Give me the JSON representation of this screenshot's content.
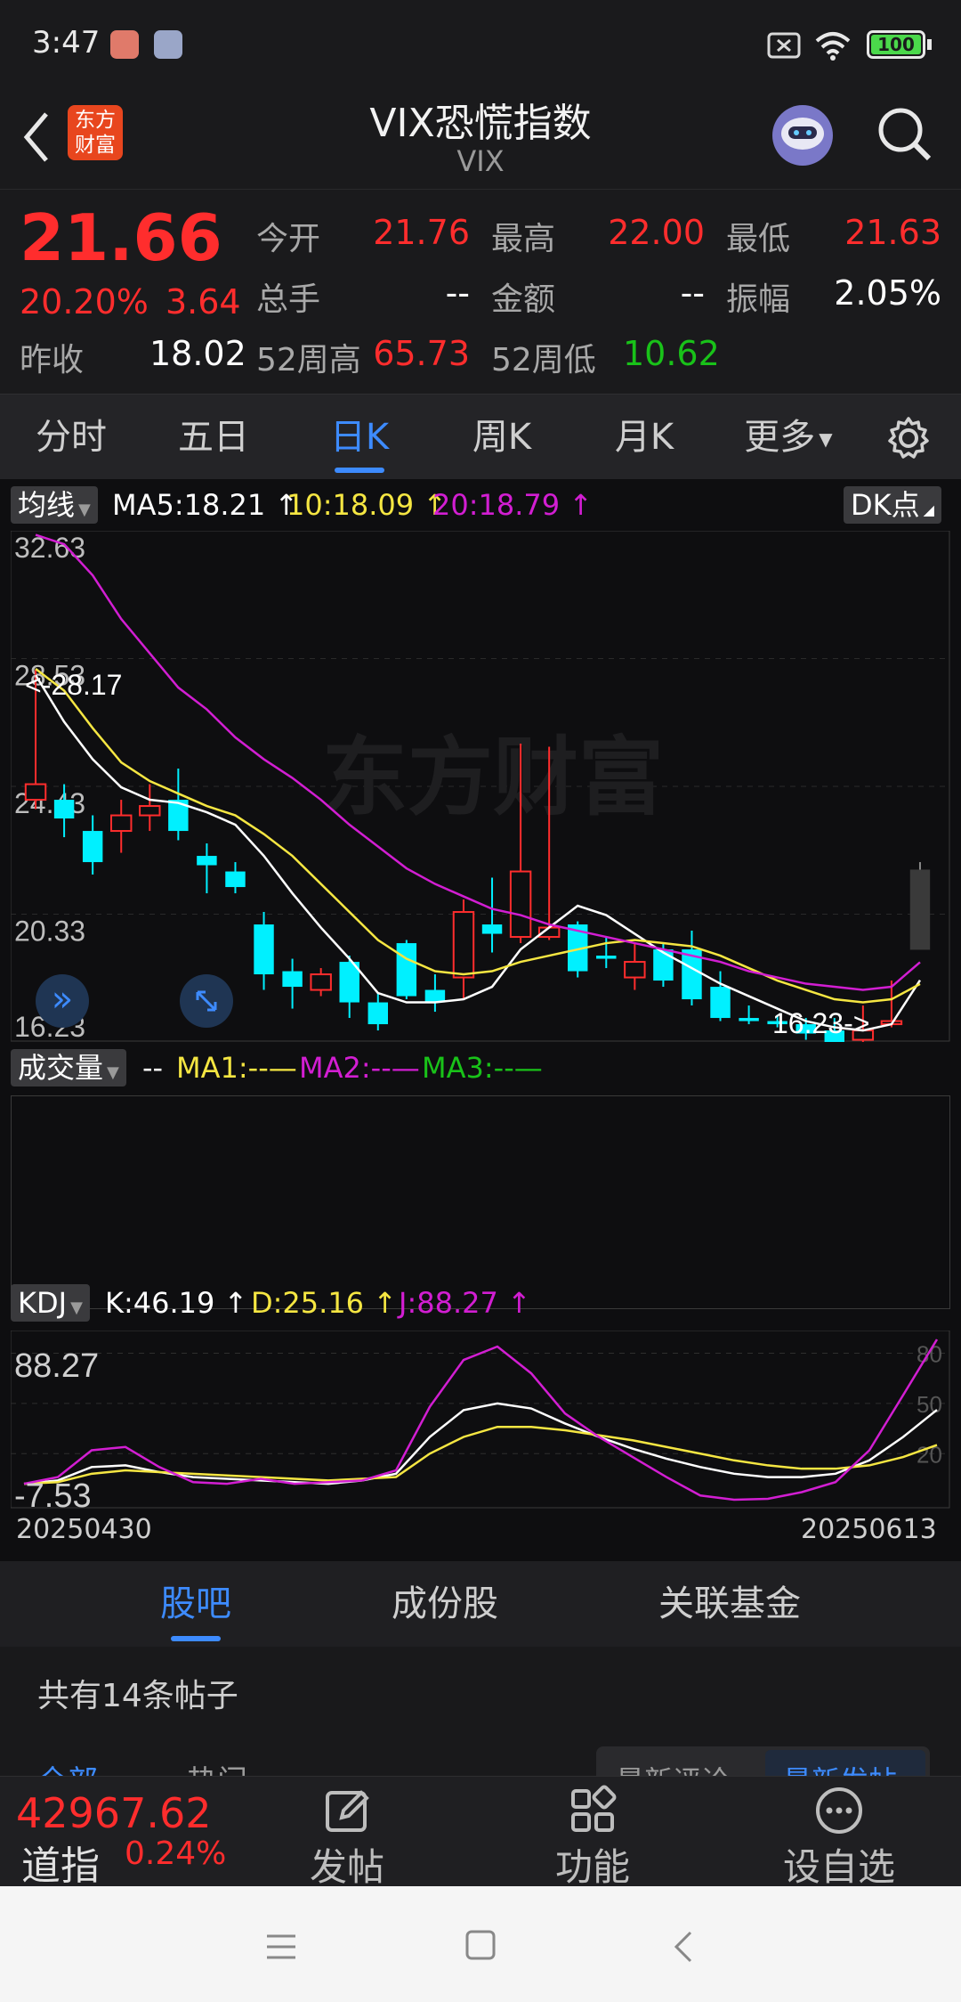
{
  "status": {
    "time": "3:47",
    "battery": "100"
  },
  "header": {
    "logo_line1": "东方",
    "logo_line2": "财富",
    "title": "VIX恐慌指数",
    "subtitle": "VIX"
  },
  "quote": {
    "price": "21.66",
    "change_pct": "20.20%",
    "change": "3.64",
    "prev_close_label": "昨收",
    "prev_close": "18.02",
    "open_label": "今开",
    "open": "21.76",
    "high_label": "最高",
    "high": "22.00",
    "low_label": "最低",
    "low": "21.63",
    "volume_label": "总手",
    "volume": "--",
    "amount_label": "金额",
    "amount": "--",
    "amplitude_label": "振幅",
    "amplitude": "2.05%",
    "wk52_high_label": "52周高",
    "wk52_high": "65.73",
    "wk52_low_label": "52周低",
    "wk52_low": "10.62"
  },
  "tabs": [
    "分时",
    "五日",
    "日K",
    "周K",
    "月K",
    "更多"
  ],
  "active_tab": "日K",
  "main_panel": {
    "selector": "均线",
    "ma5": "MA5:18.21",
    "ma10": "10:18.09",
    "ma20": "20:18.79",
    "dk_button": "DK点",
    "ticks": [
      "32.63",
      "28.53",
      "24.43",
      "20.33",
      "16.23"
    ],
    "max_label": "<-28.17",
    "min_label": "16.23->",
    "watermark": "东方财富"
  },
  "volume_panel": {
    "selector": "成交量",
    "value": "--",
    "ma1": "MA1:--",
    "ma2": "MA2:--",
    "ma3": "MA3:--"
  },
  "kdj_panel": {
    "selector": "KDJ",
    "k": "K:46.19",
    "d": "D:25.16",
    "j": "J:88.27",
    "top": "88.27",
    "bottom": "-7.53",
    "right_ticks": [
      "80",
      "50",
      "20"
    ],
    "start_date": "20250430",
    "end_date": "20250613"
  },
  "colors": {
    "up": "#ff2d2d",
    "down": "#00f0ff",
    "ma5": "#ffffff",
    "ma10": "#f5e642",
    "ma20": "#d21ed2",
    "accent": "#3d8bff"
  },
  "section_tabs": [
    "股吧",
    "成份股",
    "关联基金"
  ],
  "active_section": "股吧",
  "post_count": "共有14条帖子",
  "partial_row": {
    "left1": "全部",
    "left2": "热门",
    "right1": "最新评论",
    "right2": "最新发帖"
  },
  "bottom_bar": {
    "index_value": "42967.62",
    "index_name": "道指",
    "index_change": "0.24%",
    "post": "发帖",
    "func": "功能",
    "watch": "设自选"
  },
  "chart_data": [
    {
      "type": "candlestick",
      "title": "VIX恐慌指数 日K",
      "x_range": [
        "20250430",
        "20250613"
      ],
      "ylim": [
        16.23,
        32.63
      ],
      "y_ticks": [
        32.63,
        28.53,
        24.43,
        20.33,
        16.23
      ],
      "series": [
        {
          "name": "K",
          "ohlc": [
            [
              24.0,
              24.5,
              28.17,
              23.7
            ],
            [
              24.0,
              23.4,
              24.5,
              22.8
            ],
            [
              23.0,
              22.0,
              23.5,
              21.6
            ],
            [
              23.0,
              23.5,
              24.0,
              22.3
            ],
            [
              23.5,
              23.8,
              24.5,
              23.0
            ],
            [
              24.0,
              23.0,
              25.0,
              22.7
            ],
            [
              22.2,
              21.9,
              22.6,
              21.0
            ],
            [
              21.7,
              21.2,
              22.0,
              21.0
            ],
            [
              20.0,
              18.4,
              20.4,
              17.9
            ],
            [
              18.5,
              18.0,
              18.9,
              17.3
            ],
            [
              17.9,
              18.4,
              18.6,
              17.7
            ],
            [
              18.8,
              17.5,
              19.0,
              17.0
            ],
            [
              17.5,
              16.8,
              17.8,
              16.6
            ],
            [
              19.4,
              17.7,
              19.5,
              17.6
            ],
            [
              17.9,
              17.5,
              18.4,
              17.2
            ],
            [
              18.3,
              20.4,
              20.8,
              17.6
            ],
            [
              20.0,
              19.7,
              21.5,
              19.1
            ],
            [
              19.6,
              21.7,
              25.8,
              19.4
            ],
            [
              19.6,
              19.9,
              25.7,
              19.5
            ],
            [
              20.0,
              18.5,
              20.1,
              18.3
            ],
            [
              19.0,
              18.9,
              19.6,
              18.6
            ],
            [
              18.3,
              18.8,
              19.4,
              17.9
            ],
            [
              19.2,
              18.2,
              19.4,
              18.0
            ],
            [
              19.2,
              17.6,
              19.8,
              17.4
            ],
            [
              18.0,
              17.0,
              18.5,
              16.9
            ],
            [
              17.0,
              16.9,
              17.4,
              16.8
            ],
            [
              16.9,
              16.8,
              17.1,
              16.7
            ],
            [
              16.8,
              16.5,
              17.0,
              16.3
            ],
            [
              16.6,
              16.2,
              17.0,
              16.0
            ],
            [
              16.3,
              16.6,
              17.4,
              15.8
            ],
            [
              16.8,
              16.9,
              18.2,
              16.7
            ],
            [
              21.76,
              21.66,
              22.0,
              21.63
            ]
          ]
        },
        {
          "name": "MA5",
          "values": [
            28.0,
            26.5,
            25.3,
            24.4,
            24.0,
            23.9,
            23.6,
            23.2,
            22.2,
            21.0,
            19.9,
            18.9,
            17.8,
            17.5,
            17.5,
            17.6,
            18.0,
            19.2,
            19.9,
            20.6,
            20.3,
            19.7,
            19.1,
            18.6,
            18.1,
            17.7,
            17.3,
            16.9,
            16.7,
            16.6,
            16.8,
            18.21
          ]
        },
        {
          "name": "MA10",
          "values": [
            28.2,
            27.5,
            26.3,
            25.2,
            24.6,
            24.2,
            23.8,
            23.5,
            22.9,
            22.2,
            21.3,
            20.4,
            19.5,
            18.9,
            18.5,
            18.4,
            18.5,
            18.8,
            19.0,
            19.2,
            19.4,
            19.5,
            19.4,
            19.3,
            19.0,
            18.6,
            18.2,
            17.9,
            17.6,
            17.5,
            17.6,
            18.09
          ]
        },
        {
          "name": "MA20",
          "values": [
            32.5,
            32.2,
            31.2,
            29.8,
            28.7,
            27.6,
            26.9,
            26.0,
            25.3,
            24.7,
            24.0,
            23.2,
            22.5,
            21.8,
            21.3,
            20.9,
            20.5,
            20.3,
            20.0,
            19.8,
            19.6,
            19.4,
            19.2,
            19.0,
            18.8,
            18.5,
            18.3,
            18.1,
            18.0,
            17.9,
            18.0,
            18.79
          ]
        }
      ]
    },
    {
      "type": "line",
      "title": "KDJ",
      "ylim": [
        -7.53,
        88.27
      ],
      "series": [
        {
          "name": "K",
          "values": [
            2,
            4,
            12,
            13,
            9,
            6,
            5,
            4,
            3,
            2,
            4,
            8,
            30,
            46,
            50,
            47,
            38,
            30,
            23,
            17,
            12,
            8,
            6,
            6,
            8,
            16,
            30,
            46.19
          ]
        },
        {
          "name": "D",
          "values": [
            2,
            3,
            8,
            10,
            9,
            8,
            7,
            6,
            5,
            4,
            5,
            6,
            20,
            30,
            36,
            36,
            34,
            31,
            28,
            24,
            20,
            16,
            13,
            11,
            11,
            13,
            18,
            25.16
          ]
        },
        {
          "name": "J",
          "values": [
            2,
            6,
            22,
            24,
            12,
            3,
            2,
            5,
            2,
            3,
            4,
            10,
            48,
            76,
            84,
            68,
            44,
            30,
            18,
            6,
            -5,
            -7.53,
            -7,
            -3,
            3,
            22,
            55,
            88.27
          ]
        }
      ]
    }
  ]
}
